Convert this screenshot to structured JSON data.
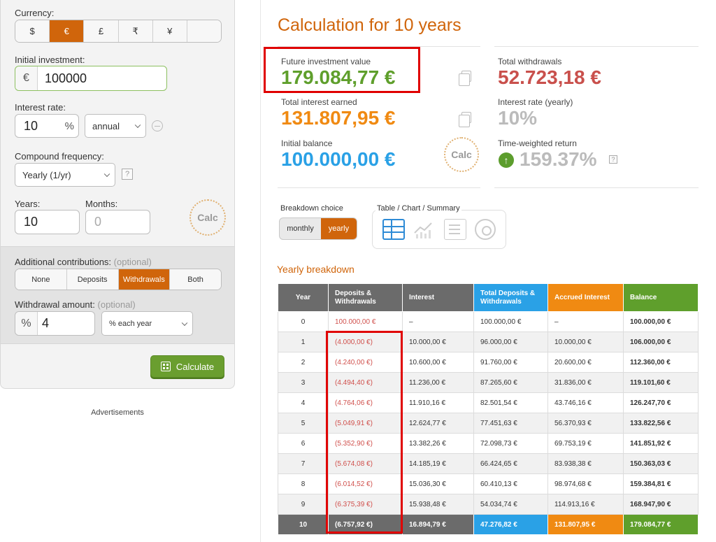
{
  "left": {
    "currency_label": "Currency:",
    "currencies": [
      "$",
      "€",
      "£",
      "₹",
      "¥",
      ""
    ],
    "initial_label": "Initial investment:",
    "initial_prefix": "€",
    "initial_value": "100000",
    "rate_label": "Interest rate:",
    "rate_value": "10",
    "rate_unit": "%",
    "rate_period": "annual",
    "compound_label": "Compound frequency:",
    "compound_value": "Yearly (1/yr)",
    "help": "?",
    "years_label": "Years:",
    "years_value": "10",
    "months_label": "Months:",
    "months_placeholder": "0",
    "logo_text": "Calc",
    "additional_label": "Additional contributions:",
    "optional": "(optional)",
    "contrib_options": [
      "None",
      "Deposits",
      "Withdrawals",
      "Both"
    ],
    "withdrawal_label": "Withdrawal amount:",
    "withdrawal_prefix": "%",
    "withdrawal_value": "4",
    "withdrawal_period": "% each year",
    "calculate": "Calculate",
    "ads": "Advertisements"
  },
  "right": {
    "title": "Calculation for 10 years",
    "fiv_label": "Future investment value",
    "fiv_value": "179.084,77 €",
    "tw_label": "Total withdrawals",
    "tw_value": "52.723,18 €",
    "tie_label": "Total interest earned",
    "tie_value": "131.807,95 €",
    "ir_label": "Interest rate (yearly)",
    "ir_value": "10%",
    "ib_label": "Initial balance",
    "ib_value": "100.000,00 €",
    "twr_label": "Time-weighted return",
    "twr_value": "159.37%",
    "help": "?",
    "logo_text": "Calc",
    "breakdown_label": "Breakdown choice",
    "breakdown_options": [
      "monthly",
      "yearly"
    ],
    "view_label": "Table / Chart / Summary",
    "yearly_breakdown": "Yearly breakdown",
    "colors": {
      "accent": "#d0650b",
      "green": "#5f9f2c",
      "blue": "#2aa1e6",
      "orange": "#f08a12",
      "red": "#d0504c"
    }
  },
  "table": {
    "headers": [
      "Year",
      "Deposits & Withdrawals",
      "Interest",
      "Total Deposits & Withdrawals",
      "Accrued Interest",
      "Balance"
    ],
    "rows": [
      [
        "0",
        "100.000,00 €",
        "–",
        "100.000,00 €",
        "–",
        "100.000,00 €"
      ],
      [
        "1",
        "(4.000,00 €)",
        "10.000,00 €",
        "96.000,00 €",
        "10.000,00 €",
        "106.000,00 €"
      ],
      [
        "2",
        "(4.240,00 €)",
        "10.600,00 €",
        "91.760,00 €",
        "20.600,00 €",
        "112.360,00 €"
      ],
      [
        "3",
        "(4.494,40 €)",
        "11.236,00 €",
        "87.265,60 €",
        "31.836,00 €",
        "119.101,60 €"
      ],
      [
        "4",
        "(4.764,06 €)",
        "11.910,16 €",
        "82.501,54 €",
        "43.746,16 €",
        "126.247,70 €"
      ],
      [
        "5",
        "(5.049,91 €)",
        "12.624,77 €",
        "77.451,63 €",
        "56.370,93 €",
        "133.822,56 €"
      ],
      [
        "6",
        "(5.352,90 €)",
        "13.382,26 €",
        "72.098,73 €",
        "69.753,19 €",
        "141.851,92 €"
      ],
      [
        "7",
        "(5.674,08 €)",
        "14.185,19 €",
        "66.424,65 €",
        "83.938,38 €",
        "150.363,03 €"
      ],
      [
        "8",
        "(6.014,52 €)",
        "15.036,30 €",
        "60.410,13 €",
        "98.974,68 €",
        "159.384,81 €"
      ],
      [
        "9",
        "(6.375,39 €)",
        "15.938,48 €",
        "54.034,74 €",
        "114.913,16 €",
        "168.947,90 €"
      ]
    ],
    "total": [
      "10",
      "(6.757,92 €)",
      "16.894,79 €",
      "47.276,82 €",
      "131.807,95 €",
      "179.084,77 €"
    ]
  }
}
